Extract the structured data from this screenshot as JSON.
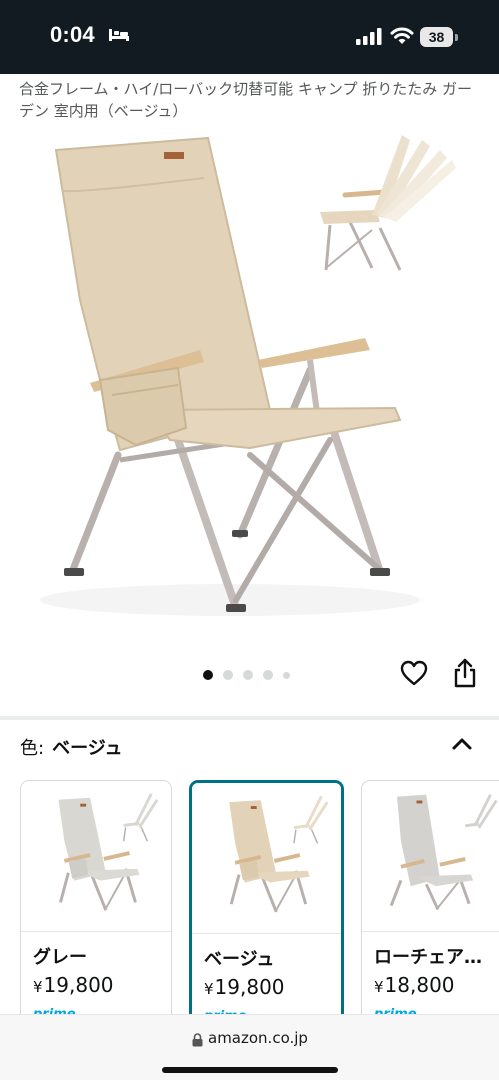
{
  "status_bar": {
    "time": "0:04",
    "battery": "38",
    "icons": [
      "sleep-icon",
      "signal-icon",
      "wifi-icon",
      "battery-icon"
    ]
  },
  "product": {
    "title": "合金フレーム・ハイ/ローバック切替可能 キャンプ 折りたたみ ガーデン 室内用（ベージュ）"
  },
  "carousel": {
    "total_images": 5,
    "active_index": 0,
    "icons": [
      "heart-icon",
      "share-icon"
    ]
  },
  "color_selector": {
    "label": "色:",
    "selected": "ベージュ",
    "icon": "chevron-up-icon"
  },
  "variants": [
    {
      "name": "グレー",
      "currency": "¥",
      "price": "19,800",
      "prime": "prime",
      "selected": false
    },
    {
      "name": "ベージュ",
      "currency": "¥",
      "price": "19,800",
      "prime": "prime",
      "selected": true
    },
    {
      "name": "ローチェア…",
      "currency": "¥",
      "price": "18,800",
      "prime": "prime",
      "selected": false
    }
  ],
  "colors": {
    "status_bg": "#121a22",
    "selected_border": "#007185",
    "fabric_beige": "#e2d2b8",
    "fabric_gray": "#d9d7d2",
    "frame": "#b8b0ad"
  },
  "browser": {
    "url": "amazon.co.jp",
    "icon": "lock-icon"
  }
}
